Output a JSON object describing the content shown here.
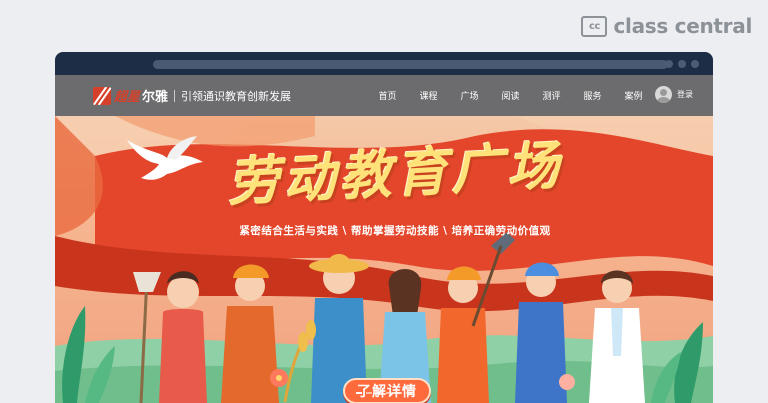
{
  "watermark": {
    "badge": "cc",
    "name": "class central"
  },
  "site": {
    "brand_script": "超星",
    "brand_name": "尔雅",
    "slogan": "引领通识教育创新发展"
  },
  "nav": {
    "items": [
      {
        "label": "首页"
      },
      {
        "label": "课程"
      },
      {
        "label": "广场"
      },
      {
        "label": "阅读"
      },
      {
        "label": "测评"
      },
      {
        "label": "服务"
      },
      {
        "label": "案例"
      }
    ],
    "login": "登录"
  },
  "banner": {
    "headline": "劳动教育广场",
    "subline": "紧密结合生活与实践 \\ 帮助掌握劳动技能 \\ 培养正确劳动价值观",
    "cta": "了解详情",
    "slides": 6,
    "active_slide": 1
  },
  "colors": {
    "window_frame": "#1d2d46",
    "nav_bg": "#6c6c6e",
    "banner_red": "#e4462b",
    "headline": "#ffe27a",
    "cta": "#ff6a3d"
  }
}
